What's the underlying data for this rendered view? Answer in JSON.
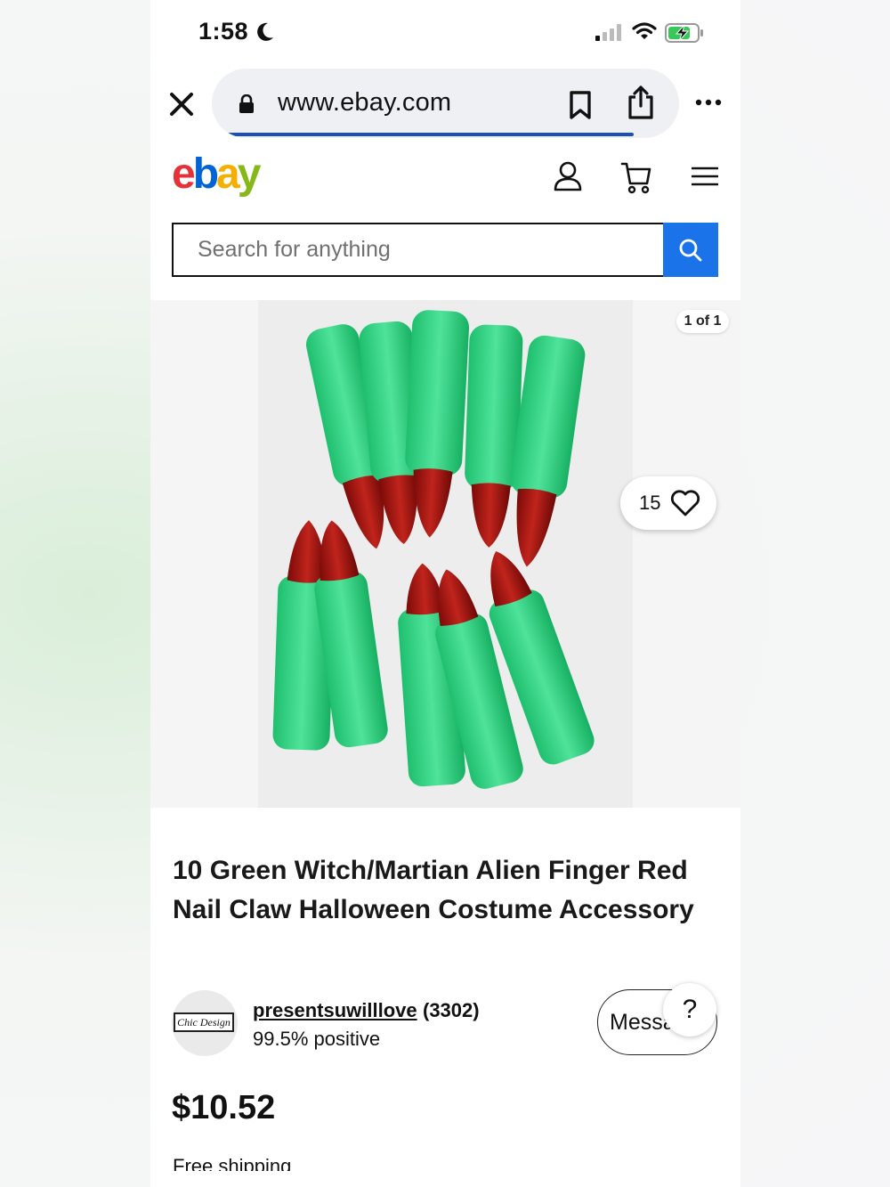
{
  "status_bar": {
    "time": "1:58"
  },
  "browser": {
    "url": "www.ebay.com"
  },
  "header": {
    "logo": {
      "e": "e",
      "b": "b",
      "a": "a",
      "y": "y"
    }
  },
  "search": {
    "placeholder": "Search for anything"
  },
  "gallery": {
    "counter": "1 of 1",
    "watch_count": "15"
  },
  "listing": {
    "title": "10 Green Witch/Martian Alien Finger Red Nail Claw Halloween Costume Accessory",
    "price": "$10.52",
    "shipping": "Free shipping"
  },
  "seller": {
    "logo_text": "Chic Design",
    "name": "presentsuwilllove",
    "count": "(3302)",
    "feedback": "99.5% positive",
    "message_label": "Message"
  },
  "help": {
    "label": "?"
  },
  "colors": {
    "ebay_red": "#e53238",
    "ebay_blue": "#0064d2",
    "ebay_yellow": "#f5af02",
    "ebay_green": "#86b817",
    "search_button": "#1a73e8",
    "progress": "#1b4fb5"
  },
  "icons": [
    "close-icon",
    "lock-icon",
    "bookmark-icon",
    "share-icon",
    "more-icon",
    "account-icon",
    "cart-icon",
    "menu-icon",
    "search-icon",
    "heart-icon",
    "moon-icon",
    "signal-icon",
    "wifi-icon",
    "battery-icon"
  ]
}
